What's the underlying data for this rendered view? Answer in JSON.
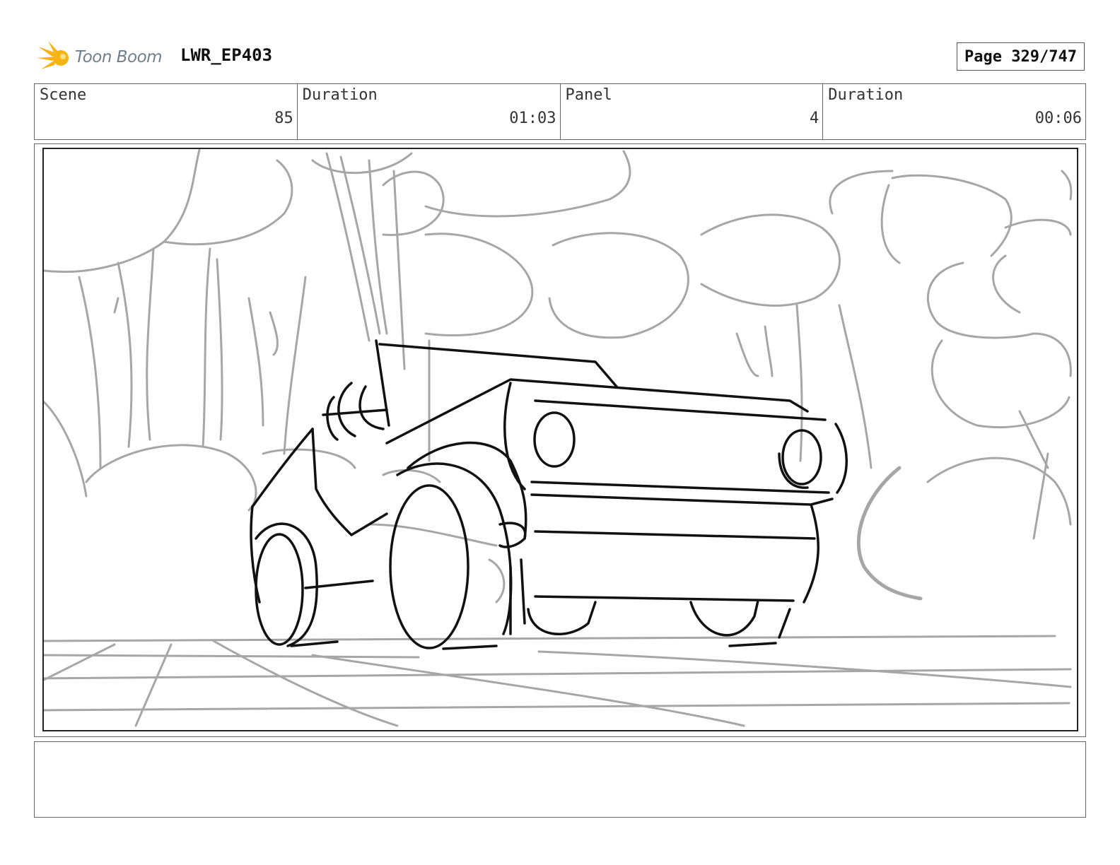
{
  "header": {
    "logo_text": "Toon Boom",
    "project": "LWR_EP403",
    "page": "Page 329/747"
  },
  "info": {
    "scene_label": "Scene",
    "scene_value": "85",
    "scene_duration_label": "Duration",
    "scene_duration_value": "01:03",
    "panel_label": "Panel",
    "panel_value": "4",
    "panel_duration_label": "Duration",
    "panel_duration_value": "00:06"
  },
  "notes": {
    "text": ""
  },
  "colors": {
    "logo_star": "#f5b414",
    "logo_text": "#6f7f8c",
    "sketch_light": "#a6a6a6",
    "sketch_dark": "#111111"
  },
  "icons": {
    "logo": "toon-boom-star-icon"
  }
}
